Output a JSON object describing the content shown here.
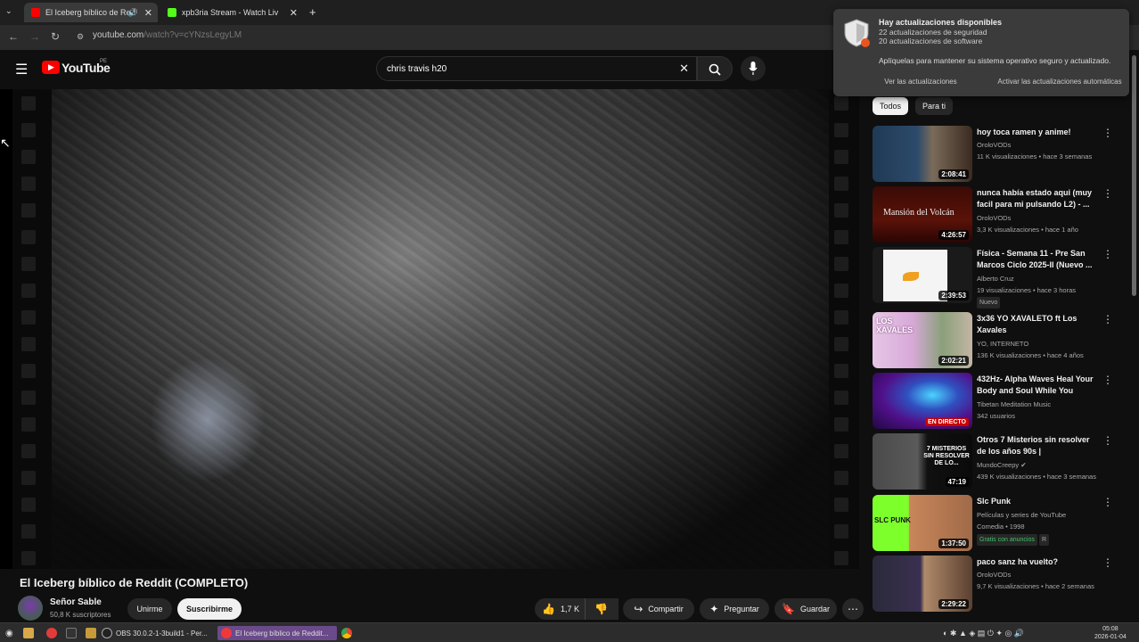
{
  "browser": {
    "tabs": [
      {
        "title": "El Iceberg bíblico de Red",
        "active": true
      },
      {
        "title": "xpb3ria Stream - Watch Liv",
        "active": false
      }
    ],
    "url_host": "youtube.com",
    "url_path": "/watch?v=cYNzsLegyLM"
  },
  "youtube": {
    "logo": "YouTube",
    "region": "PE",
    "search_value": "chris travis h20",
    "video_title": "El Iceberg bíblico de Reddit (COMPLETO)",
    "channel_name": "Señor Sable",
    "subscribers": "50,8 K suscriptores",
    "join_label": "Unirme",
    "subscribe_label": "Suscribirme",
    "likes": "1,7 K",
    "share_label": "Compartir",
    "ask_label": "Preguntar",
    "save_label": "Guardar"
  },
  "chips": [
    "Todos",
    "Para ti"
  ],
  "recommendations": [
    {
      "title": "hoy toca ramen y anime!",
      "channel": "OroloVODs",
      "meta": "11 K visualizaciones • hace 3 semanas",
      "duration": "2:08:41"
    },
    {
      "title": "nunca había estado aqui (muy facil para mi pulsando L2) - ...",
      "channel": "OroloVODs",
      "meta": "3,3 K visualizaciones • hace 1 año",
      "duration": "4:26:57",
      "thumb_text": "Mansión del Volcán"
    },
    {
      "title": "Física - Semana 11 - Pre San Marcos Ciclo 2025-II (Nuevo ...",
      "channel": "Alberto Cruz",
      "meta": "19 visualizaciones • hace 3 horas",
      "duration": "2:39:53",
      "badge": "Nuevo"
    },
    {
      "title": "3x36 YO XAVALETO ft Los Xavales",
      "channel": "YO, INTERNETO",
      "meta": "136 K visualizaciones • hace 4 años",
      "duration": "2:02:21",
      "thumb_text": "LOS XAVALES"
    },
    {
      "title": "432Hz- Alpha Waves Heal Your Body and Soul While You Slee...",
      "channel": "Tibetan Meditation Music",
      "meta": "342 usuarios",
      "duration": "EN DIRECTO"
    },
    {
      "title": "Otros 7 Misterios sin resolver de los años 90s | MundoCreepy",
      "channel": "MundoCreepy",
      "meta": "439 K visualizaciones • hace 3 semanas",
      "duration": "47:19",
      "thumb_text": "7 MISTERIOS SIN RESOLVER DE LO..."
    },
    {
      "title": "Slc Punk",
      "channel": "Películas y series de YouTube",
      "meta": "Comedia • 1998",
      "duration": "1:37:50",
      "badge": "Gratis con anuncios",
      "badge2": "R",
      "thumb_text": "SLC PUNK"
    },
    {
      "title": "paco sanz ha vuelto?",
      "channel": "OroloVODs",
      "meta": "9,7 K visualizaciones • hace 2 semanas",
      "duration": "2:29:22"
    }
  ],
  "notification": {
    "title": "Hay actualizaciones disponibles",
    "line1": "22 actualizaciones de seguridad",
    "line2": "20 actualizaciones de software",
    "body": "Aplíquelas para mantener su sistema operativo seguro y actualizado.",
    "btn_view": "Ver las actualizaciones",
    "btn_auto": "Activar las actualizaciones automáticas"
  },
  "taskbar": {
    "obs": "OBS 30.0.2-1-3build1 - Per...",
    "browser": "El Iceberg bíblico de Reddit...",
    "time": "05:08",
    "date": "2026-01-04"
  },
  "colors": {
    "yt_red": "#ff0000",
    "accent": "#3ea6ff"
  }
}
